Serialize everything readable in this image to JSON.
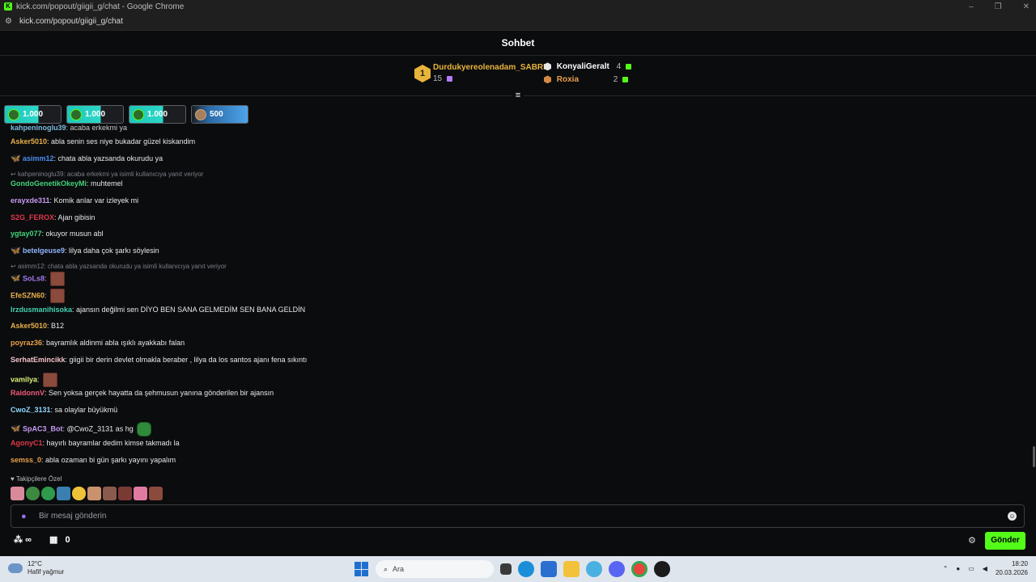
{
  "browser": {
    "window_title": "kick.com/popout/giigii_g/chat - Google Chrome",
    "url": "kick.com/popout/giigii_g/chat",
    "controls": [
      "–",
      "❐",
      "✕"
    ]
  },
  "header": {
    "title": "Sohbet"
  },
  "leaderboard": {
    "first": {
      "rank": "1",
      "name": "Durdukyereolenadam_SABRI",
      "count": "15"
    },
    "second": {
      "name": "KonyaliGeralt",
      "count": "4"
    },
    "third": {
      "name": "Roxia",
      "count": "2"
    },
    "toggle_icon": "≡"
  },
  "pinned": [
    {
      "amount": "1.000"
    },
    {
      "amount": "1.000"
    },
    {
      "amount": "1.000"
    },
    {
      "amount": "500"
    }
  ],
  "chat": {
    "partial_top": {
      "user": "kahpeninoglu39",
      "text": ": acaba erkekmi ya"
    },
    "messages": [
      {
        "user": "Asker5010",
        "text": ": abla senin ses niye bukadar güzel kiskandim",
        "color": "#e9b04a"
      },
      {
        "user": "asimm12",
        "text": ": chata abla yazsanda okurudu ya",
        "color": "#4a8df0",
        "badge": "butterfly"
      },
      {
        "reply": "kahpeninoglu39: acaba erkekmi ya isimli kullanıcıya yanıt veriyor"
      },
      {
        "user": "GondoGenetikOkeyMi",
        "text": ": muhtemel",
        "color": "#43d37a"
      },
      {
        "user": "erayxde311",
        "text": ": Komik anlar var izleyek mi",
        "color": "#c79bf2"
      },
      {
        "user": "S2G_FEROX",
        "text": ": Ajan gibisin",
        "color": "#e0384a"
      },
      {
        "user": "ygtay077",
        "text": ": okuyor musun abl",
        "color": "#43d37a"
      },
      {
        "user": "betelgeuse9",
        "text": ": lilya daha çok şarkı söylesin",
        "color": "#8fb6ff",
        "badge": "butterfly"
      },
      {
        "reply": "asimm12: chata abla yazsanda okurudu ya isimli kullanıcıya yanıt veriyor"
      },
      {
        "user": "SoLs8",
        "text": ":",
        "color": "#a27af0",
        "badge": "butterfly",
        "emote": "face"
      },
      {
        "user": "EfeSZN60",
        "text": ":",
        "color": "#e9b04a",
        "emote": "face"
      },
      {
        "user": "Irzdusmanihisoka",
        "text": ": ajansın değilmi sen DİYO BEN SANA GELMEDİM SEN BANA GELDİN",
        "color": "#43d3b0"
      },
      {
        "user": "Asker5010",
        "text": ": B12",
        "color": "#e9b04a"
      },
      {
        "user": "poyraz36",
        "text": ": bayramlık aldinmi abla ışıklı ayakkabı falan",
        "color": "#e9a24a"
      },
      {
        "user": "SerhatEmincikk",
        "text": ": giigii bir derin devlet olmakla beraber , lilya da los santos ajanı fena sıkıntı",
        "color": "#f2c0c9"
      },
      {
        "user": "vamilya",
        "text": ":",
        "color": "#d9f27a",
        "emote": "face"
      },
      {
        "user": "RaidonnV",
        "text": ": Sen yoksa gerçek hayatta da şehmusun yanına gönderilen bir ajansın",
        "color": "#f05a7a"
      },
      {
        "user": "CwoZ_3131",
        "text": ": sa olaylar büyükmü",
        "color": "#8fd8ff"
      },
      {
        "user": "SpAC3_Bot",
        "text": ": @CwoZ_3131 as hg",
        "color": "#c79bf2",
        "badge": "butterfly",
        "emote": "frog"
      },
      {
        "user": "AgonyC1",
        "text": ": hayırlı bayramlar dedim kimse takmadı la",
        "color": "#e0384a"
      },
      {
        "user": "semss_0",
        "text": ": abla ozaman bi gün şarkı yayını yapalım",
        "color": "#e9a24a"
      }
    ]
  },
  "followers_label": "Takipçilere Özel",
  "input": {
    "placeholder": "Bir mesaj gönderin"
  },
  "bottom": {
    "points": "∞",
    "store_count": "0",
    "send_label": "Gönder"
  },
  "taskbar": {
    "weather_temp": "12°C",
    "weather_desc": "Hafif yağmur",
    "search_placeholder": "Ara",
    "time": "18:20",
    "date": "20.03.2026"
  },
  "colors": {
    "accent": "#53fc18",
    "background": "#0b0c0e"
  }
}
